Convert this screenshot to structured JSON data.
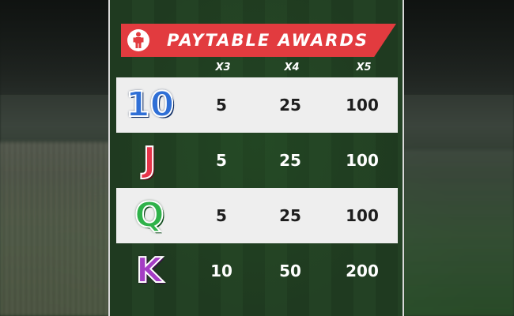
{
  "banner": {
    "title": "PAYTABLE AWARDS",
    "icon": "player-icon",
    "color": "#e23b3f"
  },
  "columns": [
    "X3",
    "X4",
    "X5"
  ],
  "rows": [
    {
      "symbol": "10",
      "symbol_color": "#2f6fd6",
      "values": [
        "5",
        "25",
        "100"
      ]
    },
    {
      "symbol": "J",
      "symbol_color": "#e7344a",
      "values": [
        "5",
        "25",
        "100"
      ]
    },
    {
      "symbol": "Q",
      "symbol_color": "#2fb24a",
      "values": [
        "5",
        "25",
        "100"
      ]
    },
    {
      "symbol": "K",
      "symbol_color": "#a43dc4",
      "values": [
        "10",
        "50",
        "200"
      ]
    }
  ]
}
